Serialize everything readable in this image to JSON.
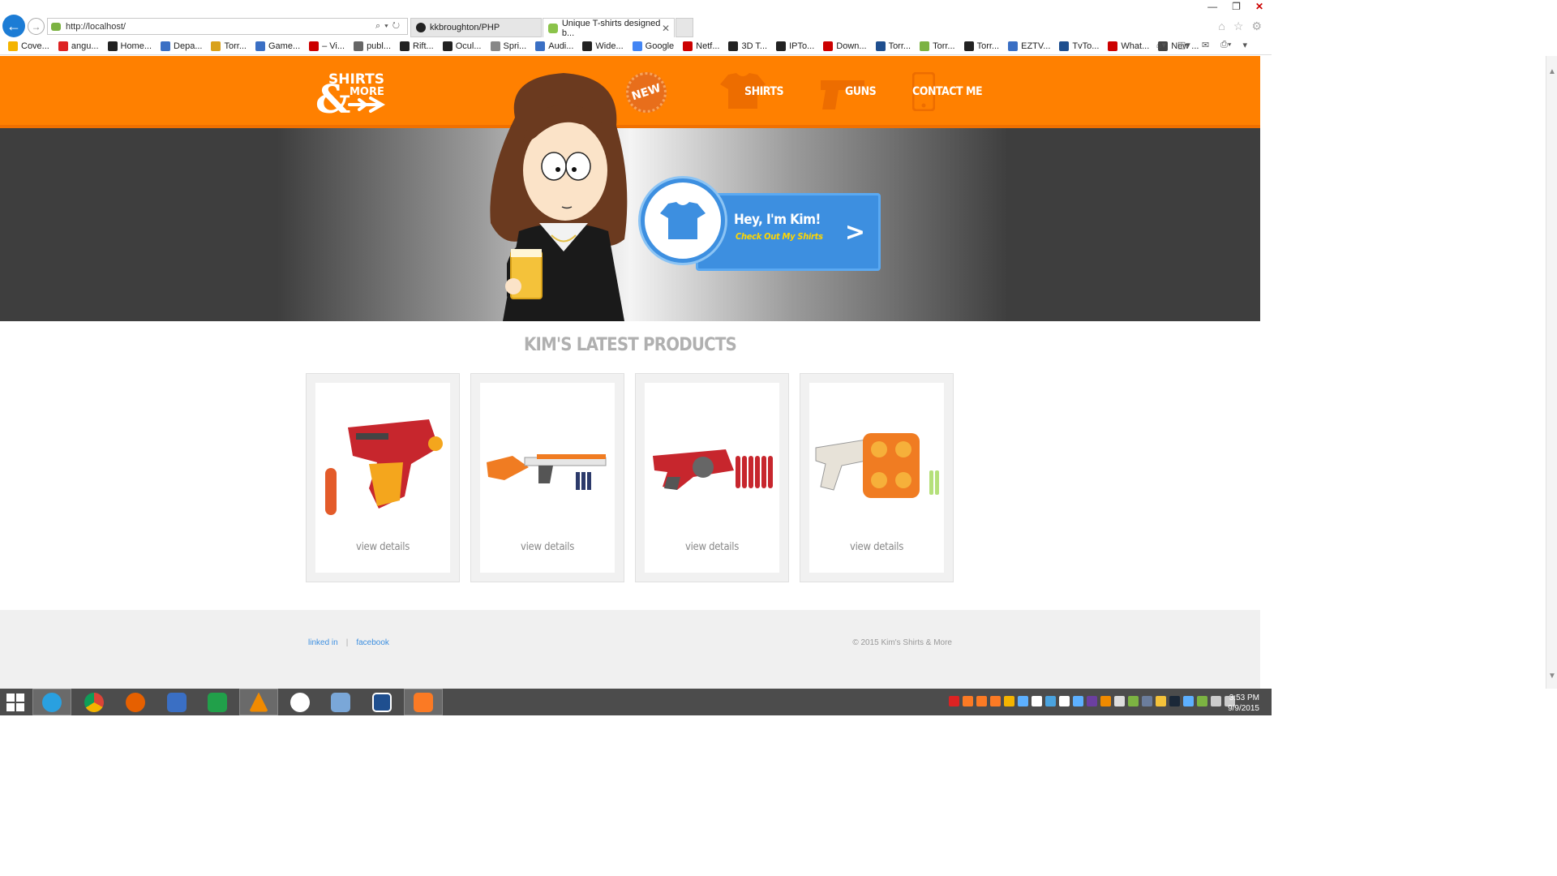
{
  "browser": {
    "address": "http://localhost/",
    "tabs": [
      {
        "label": "kkbroughton/PHP"
      },
      {
        "label": "Unique T-shirts designed b..."
      }
    ],
    "favorites": [
      "Cove...",
      "angu...",
      "Home...",
      "Depa...",
      "Torr...",
      "Game...",
      "– Vi...",
      "publ...",
      "Rift...",
      "Ocul...",
      "Spri...",
      "Audi...",
      "Wide...",
      "Google",
      "Netf...",
      "3D T...",
      "IPTo...",
      "Down...",
      "Torr...",
      "Torr...",
      "Torr...",
      "EZTV...",
      "TvTo...",
      "What...",
      "New ..."
    ]
  },
  "site": {
    "logo_text_1": "SHIRTS",
    "logo_text_2": "MORE",
    "badge": "NEW",
    "nav": {
      "shirts": "SHIRTS",
      "guns": "GUNS",
      "contact": "CONTACT ME"
    },
    "hero": {
      "title": "Hey, I'm Kim!",
      "subtitle": "Check Out My Shirts"
    },
    "products_title": "KIM'S LATEST PRODUCTS",
    "products": [
      {
        "link": "view details",
        "image": "red-yellow-nerf-blaster"
      },
      {
        "link": "view details",
        "image": "orange-white-nerf-rifle"
      },
      {
        "link": "view details",
        "image": "red-nerf-blaster-with-darts"
      },
      {
        "link": "view details",
        "image": "orange-revolver-nerf-blaster"
      }
    ],
    "footer": {
      "linkedin": "linked in",
      "separator": "|",
      "facebook": "facebook",
      "copyright": "© 2015 Kim's Shirts & More"
    }
  },
  "taskbar": {
    "time": "3:53 PM",
    "date": "9/9/2015"
  },
  "colors": {
    "header": "#ff8000",
    "accent_blue": "#3d8fe0",
    "subtitle_yellow": "#ffd600"
  }
}
